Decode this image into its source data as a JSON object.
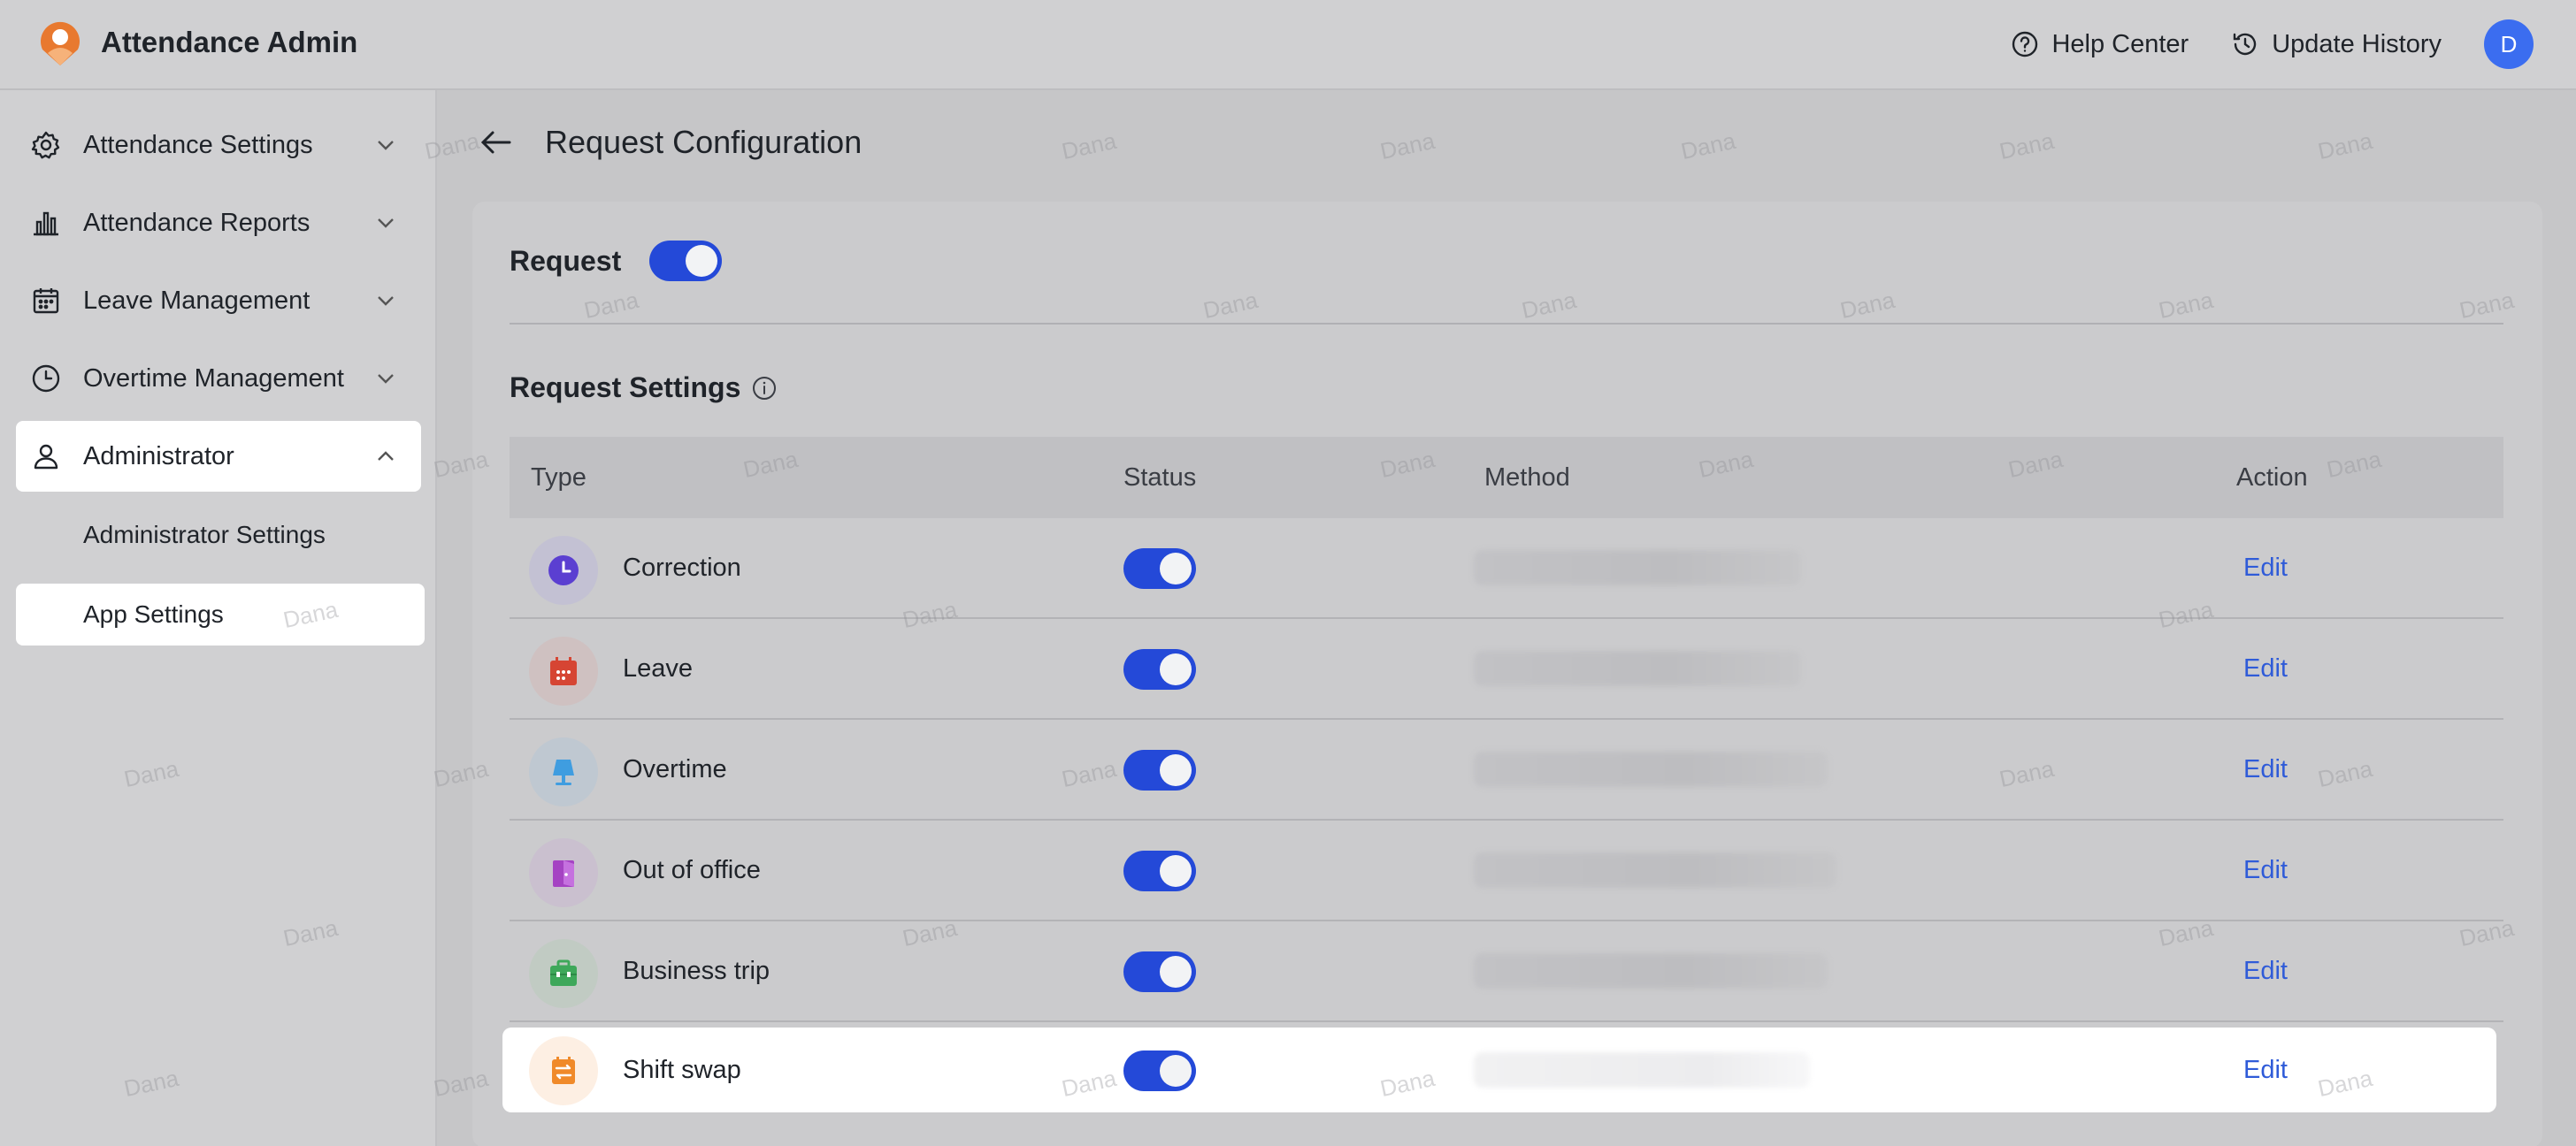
{
  "app": {
    "title": "Attendance Admin"
  },
  "header": {
    "help_label": "Help Center",
    "history_label": "Update History",
    "avatar_initial": "D"
  },
  "sidebar": {
    "items": [
      {
        "label": "Attendance Settings",
        "icon": "gear-icon"
      },
      {
        "label": "Attendance Reports",
        "icon": "bar-chart-icon"
      },
      {
        "label": "Leave Management",
        "icon": "calendar-icon"
      },
      {
        "label": "Overtime Management",
        "icon": "clock-icon"
      },
      {
        "label": "Administrator",
        "icon": "user-icon",
        "expanded": true
      }
    ],
    "sub_items": [
      {
        "label": "Administrator Settings"
      },
      {
        "label": "App Settings",
        "active": true
      }
    ]
  },
  "page": {
    "title": "Request Configuration"
  },
  "request": {
    "label": "Request",
    "enabled": true
  },
  "settings": {
    "title": "Request Settings",
    "columns": {
      "type": "Type",
      "status": "Status",
      "method": "Method",
      "action": "Action"
    },
    "rows": [
      {
        "type": "Correction",
        "icon": "clock-icon",
        "color": "#5b3fd1",
        "bg": "#c3c1d3",
        "enabled": true,
        "action": "Edit"
      },
      {
        "type": "Leave",
        "icon": "calendar-icon",
        "color": "#d64533",
        "bg": "#cfc1c1",
        "enabled": true,
        "action": "Edit"
      },
      {
        "type": "Overtime",
        "icon": "lamp-icon",
        "color": "#3f9de0",
        "bg": "#bfc8d1",
        "enabled": true,
        "action": "Edit"
      },
      {
        "type": "Out of office",
        "icon": "door-icon",
        "color": "#a543c3",
        "bg": "#cac0cf",
        "enabled": true,
        "action": "Edit"
      },
      {
        "type": "Business trip",
        "icon": "briefcase-icon",
        "color": "#3ea85a",
        "bg": "#c1cbc3",
        "enabled": true,
        "action": "Edit"
      },
      {
        "type": "Shift swap",
        "icon": "swap-icon",
        "color": "#f08a2a",
        "bg": "#fdefe3",
        "enabled": true,
        "action": "Edit"
      }
    ]
  },
  "watermark": "Dana",
  "colors": {
    "accent": "#2449d8",
    "link": "#2f5bd8"
  }
}
